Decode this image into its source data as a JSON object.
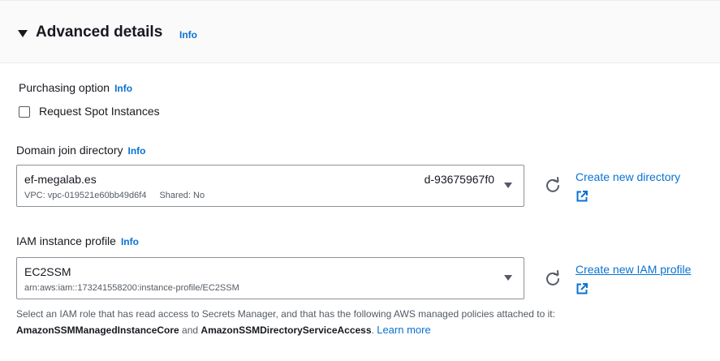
{
  "header": {
    "title": "Advanced details",
    "info": "Info"
  },
  "purchasing": {
    "label": "Purchasing option",
    "info": "Info",
    "checkbox_label": "Request Spot Instances",
    "checked": false
  },
  "domain": {
    "label": "Domain join directory",
    "info": "Info",
    "value": "ef-megalab.es",
    "directory_id": "d-93675967f0",
    "vpc": "VPC: vpc-019521e60bb49d6f4",
    "shared": "Shared: No",
    "create_link": "Create new directory"
  },
  "iam": {
    "label": "IAM instance profile",
    "info": "Info",
    "value": "EC2SSM",
    "arn": "arn:aws:iam::173241558200:instance-profile/EC2SSM",
    "create_link": "Create new IAM profile"
  },
  "help": {
    "line1": "Select an IAM role that has read access to Secrets Manager, and that has the following AWS managed policies attached to it:",
    "policy1": "AmazonSSMManagedInstanceCore",
    "and": " and ",
    "policy2": "AmazonSSMDirectoryServiceAccess",
    "period": ".",
    "learn_more": "Learn more"
  },
  "colors": {
    "link": "#0972d3",
    "text": "#16191f",
    "secondary": "#545b64",
    "border": "#8d9096"
  },
  "icons": [
    "caret-down-icon",
    "refresh-icon",
    "external-link-icon",
    "dropdown-arrow-icon"
  ]
}
